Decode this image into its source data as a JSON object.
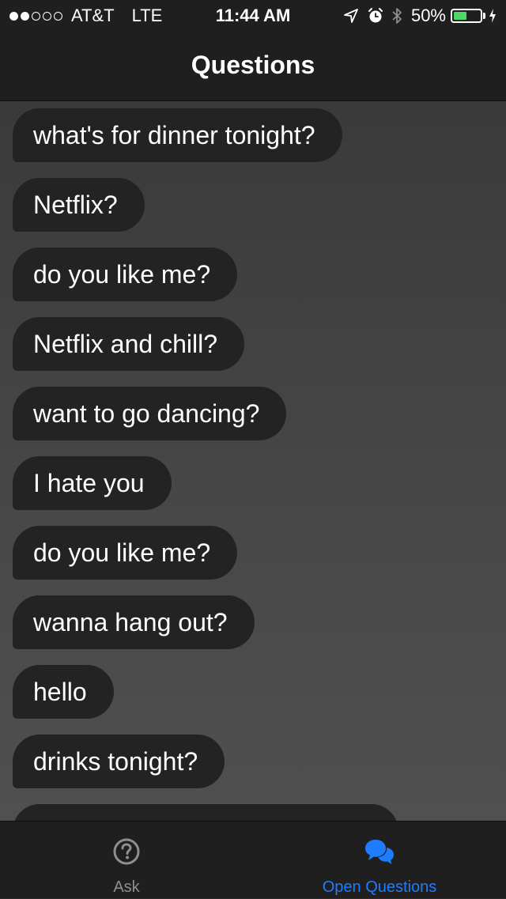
{
  "status_bar": {
    "carrier": "AT&T",
    "network": "LTE",
    "time": "11:44 AM",
    "battery_percent": "50%",
    "battery_level": 0.5,
    "signal_bars_filled": 2,
    "signal_bars_total": 5,
    "icons": [
      "location-arrow-icon",
      "alarm-clock-icon",
      "bluetooth-icon",
      "battery-icon",
      "charging-bolt-icon"
    ]
  },
  "nav": {
    "title": "Questions"
  },
  "questions": [
    "what's for dinner tonight?",
    "Netflix?",
    "do you like me?",
    "Netflix and chill?",
    "want to go dancing?",
    "I hate you",
    "do you like me?",
    "wanna hang out?",
    "hello",
    "drinks tonight?"
  ],
  "tabs": [
    {
      "label": "Ask",
      "icon": "question-circle-icon",
      "selected": false
    },
    {
      "label": "Open Questions",
      "icon": "chat-bubbles-icon",
      "selected": true
    }
  ],
  "colors": {
    "accent": "#1e7cff",
    "battery_fill": "#4cd964",
    "bubble": "#232323",
    "bar_background": "#1f1f1f",
    "inactive_tab": "#8e8e93"
  }
}
